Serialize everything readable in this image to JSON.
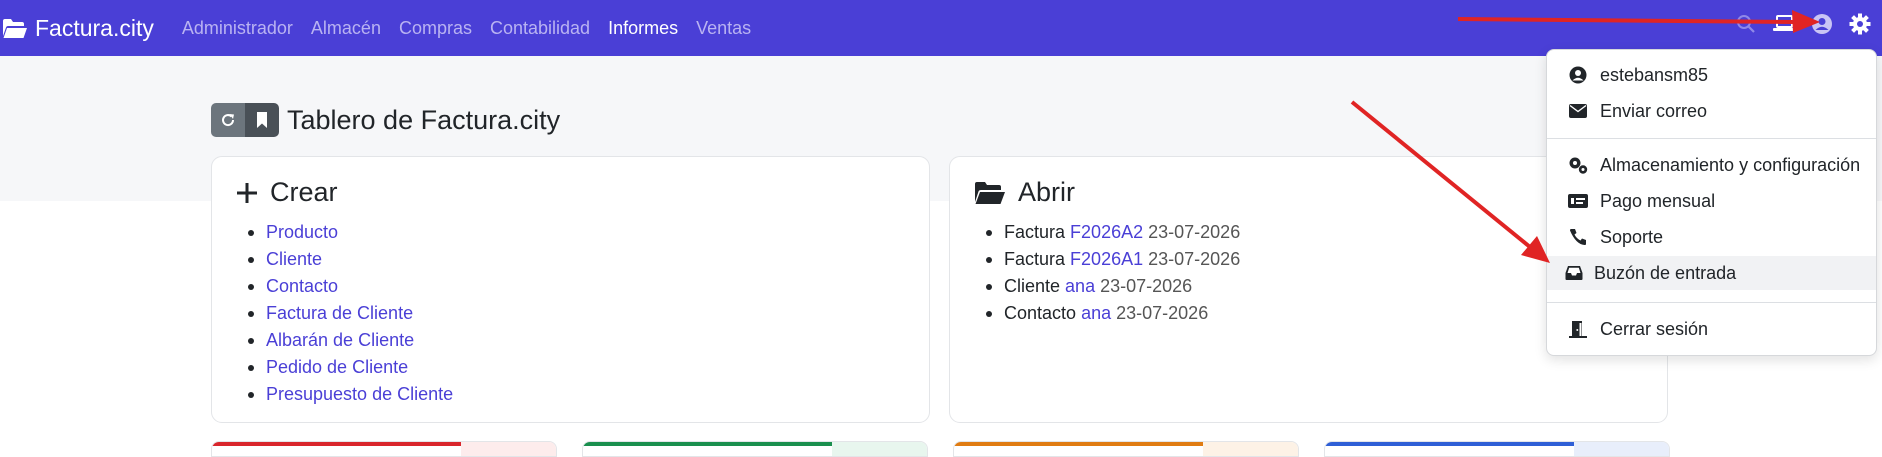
{
  "navbar": {
    "brand": "Factura.city",
    "menu": [
      {
        "label": "Administrador",
        "active": false
      },
      {
        "label": "Almacén",
        "active": false
      },
      {
        "label": "Compras",
        "active": false
      },
      {
        "label": "Contabilidad",
        "active": false
      },
      {
        "label": "Informes",
        "active": true
      },
      {
        "label": "Ventas",
        "active": false
      }
    ],
    "right_icons": [
      "search-icon",
      "laptop-icon",
      "user-icon",
      "gear-icon"
    ]
  },
  "header": {
    "title": "Tablero de Factura.city",
    "buttons": [
      "refresh-icon",
      "bookmark-icon"
    ]
  },
  "create_card": {
    "title": "Crear",
    "items": [
      "Producto",
      "Cliente",
      "Contacto",
      "Factura de Cliente",
      "Albarán de Cliente",
      "Pedido de Cliente",
      "Presupuesto de Cliente"
    ]
  },
  "open_card": {
    "title": "Abrir",
    "items": [
      {
        "type": "Factura",
        "link": "F2026A2",
        "date": "23-07-2026"
      },
      {
        "type": "Factura",
        "link": "F2026A1",
        "date": "23-07-2026"
      },
      {
        "type": "Cliente",
        "link": "ana",
        "date": "23-07-2026"
      },
      {
        "type": "Contacto",
        "link": "ana",
        "date": "23-07-2026"
      }
    ]
  },
  "user_menu": {
    "username": "estebansm85",
    "send_mail": "Enviar correo",
    "storage": "Almacenamiento y configuración",
    "billing": "Pago mensual",
    "support": "Soporte",
    "inbox": "Buzón de entrada",
    "logout": "Cerrar sesión"
  },
  "colors": {
    "navbar": "#4a3fd6",
    "link": "#4a3fd6",
    "annotation_arrow": "#e02424",
    "card_bars": [
      "#d9262c",
      "#1a8f4e",
      "#e07c12",
      "#2f5fd6"
    ]
  }
}
